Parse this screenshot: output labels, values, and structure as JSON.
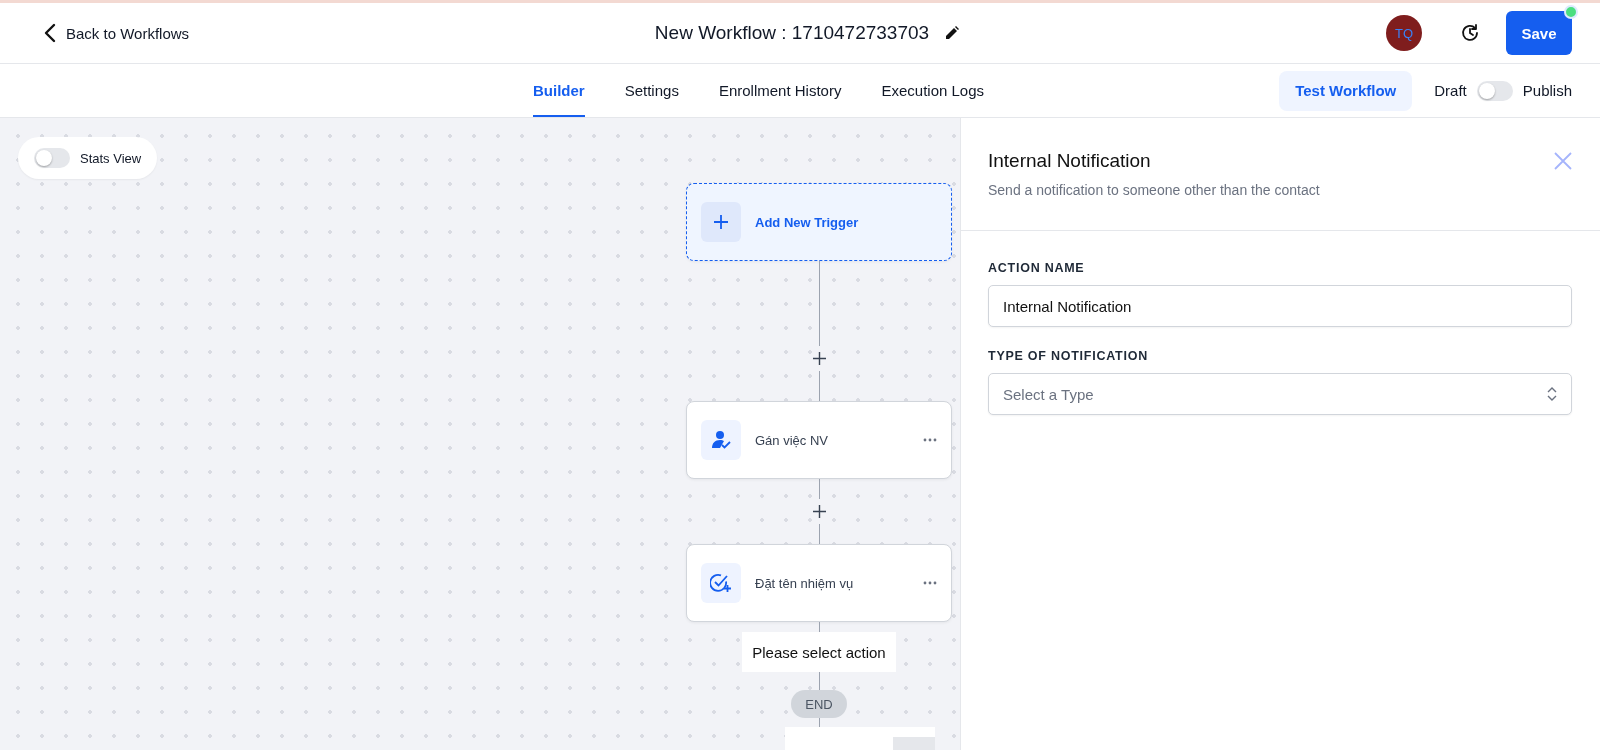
{
  "header": {
    "back_link": "Back to Workflows",
    "title": "New Workflow : 1710472733703",
    "avatar": "TQ",
    "save_button": "Save"
  },
  "tabs": [
    {
      "label": "Builder",
      "selected": true
    },
    {
      "label": "Settings",
      "selected": false
    },
    {
      "label": "Enrollment History",
      "selected": false
    },
    {
      "label": "Execution Logs",
      "selected": false
    }
  ],
  "test_button": "Test Workflow",
  "publish_toggle": {
    "off_label": "Draft",
    "on_label": "Publish",
    "on": false
  },
  "stats_view": {
    "label": "Stats View",
    "on": false
  },
  "nodes": [
    {
      "kind": "trigger",
      "label": "Add New Trigger"
    },
    {
      "kind": "assign",
      "label": "Gán việc NV"
    },
    {
      "kind": "task",
      "label": "Đặt tên nhiệm vụ"
    }
  ],
  "end_note": "Please select action",
  "end_label": "END",
  "panel": {
    "title": "Internal Notification",
    "subtitle": "Send a notification to someone other than the contact",
    "fields": [
      {
        "kind": "text",
        "label": "ACTION NAME",
        "value": "Internal Notification"
      },
      {
        "kind": "select",
        "label": "TYPE OF NOTIFICATION",
        "placeholder": "Select a Type"
      }
    ]
  }
}
